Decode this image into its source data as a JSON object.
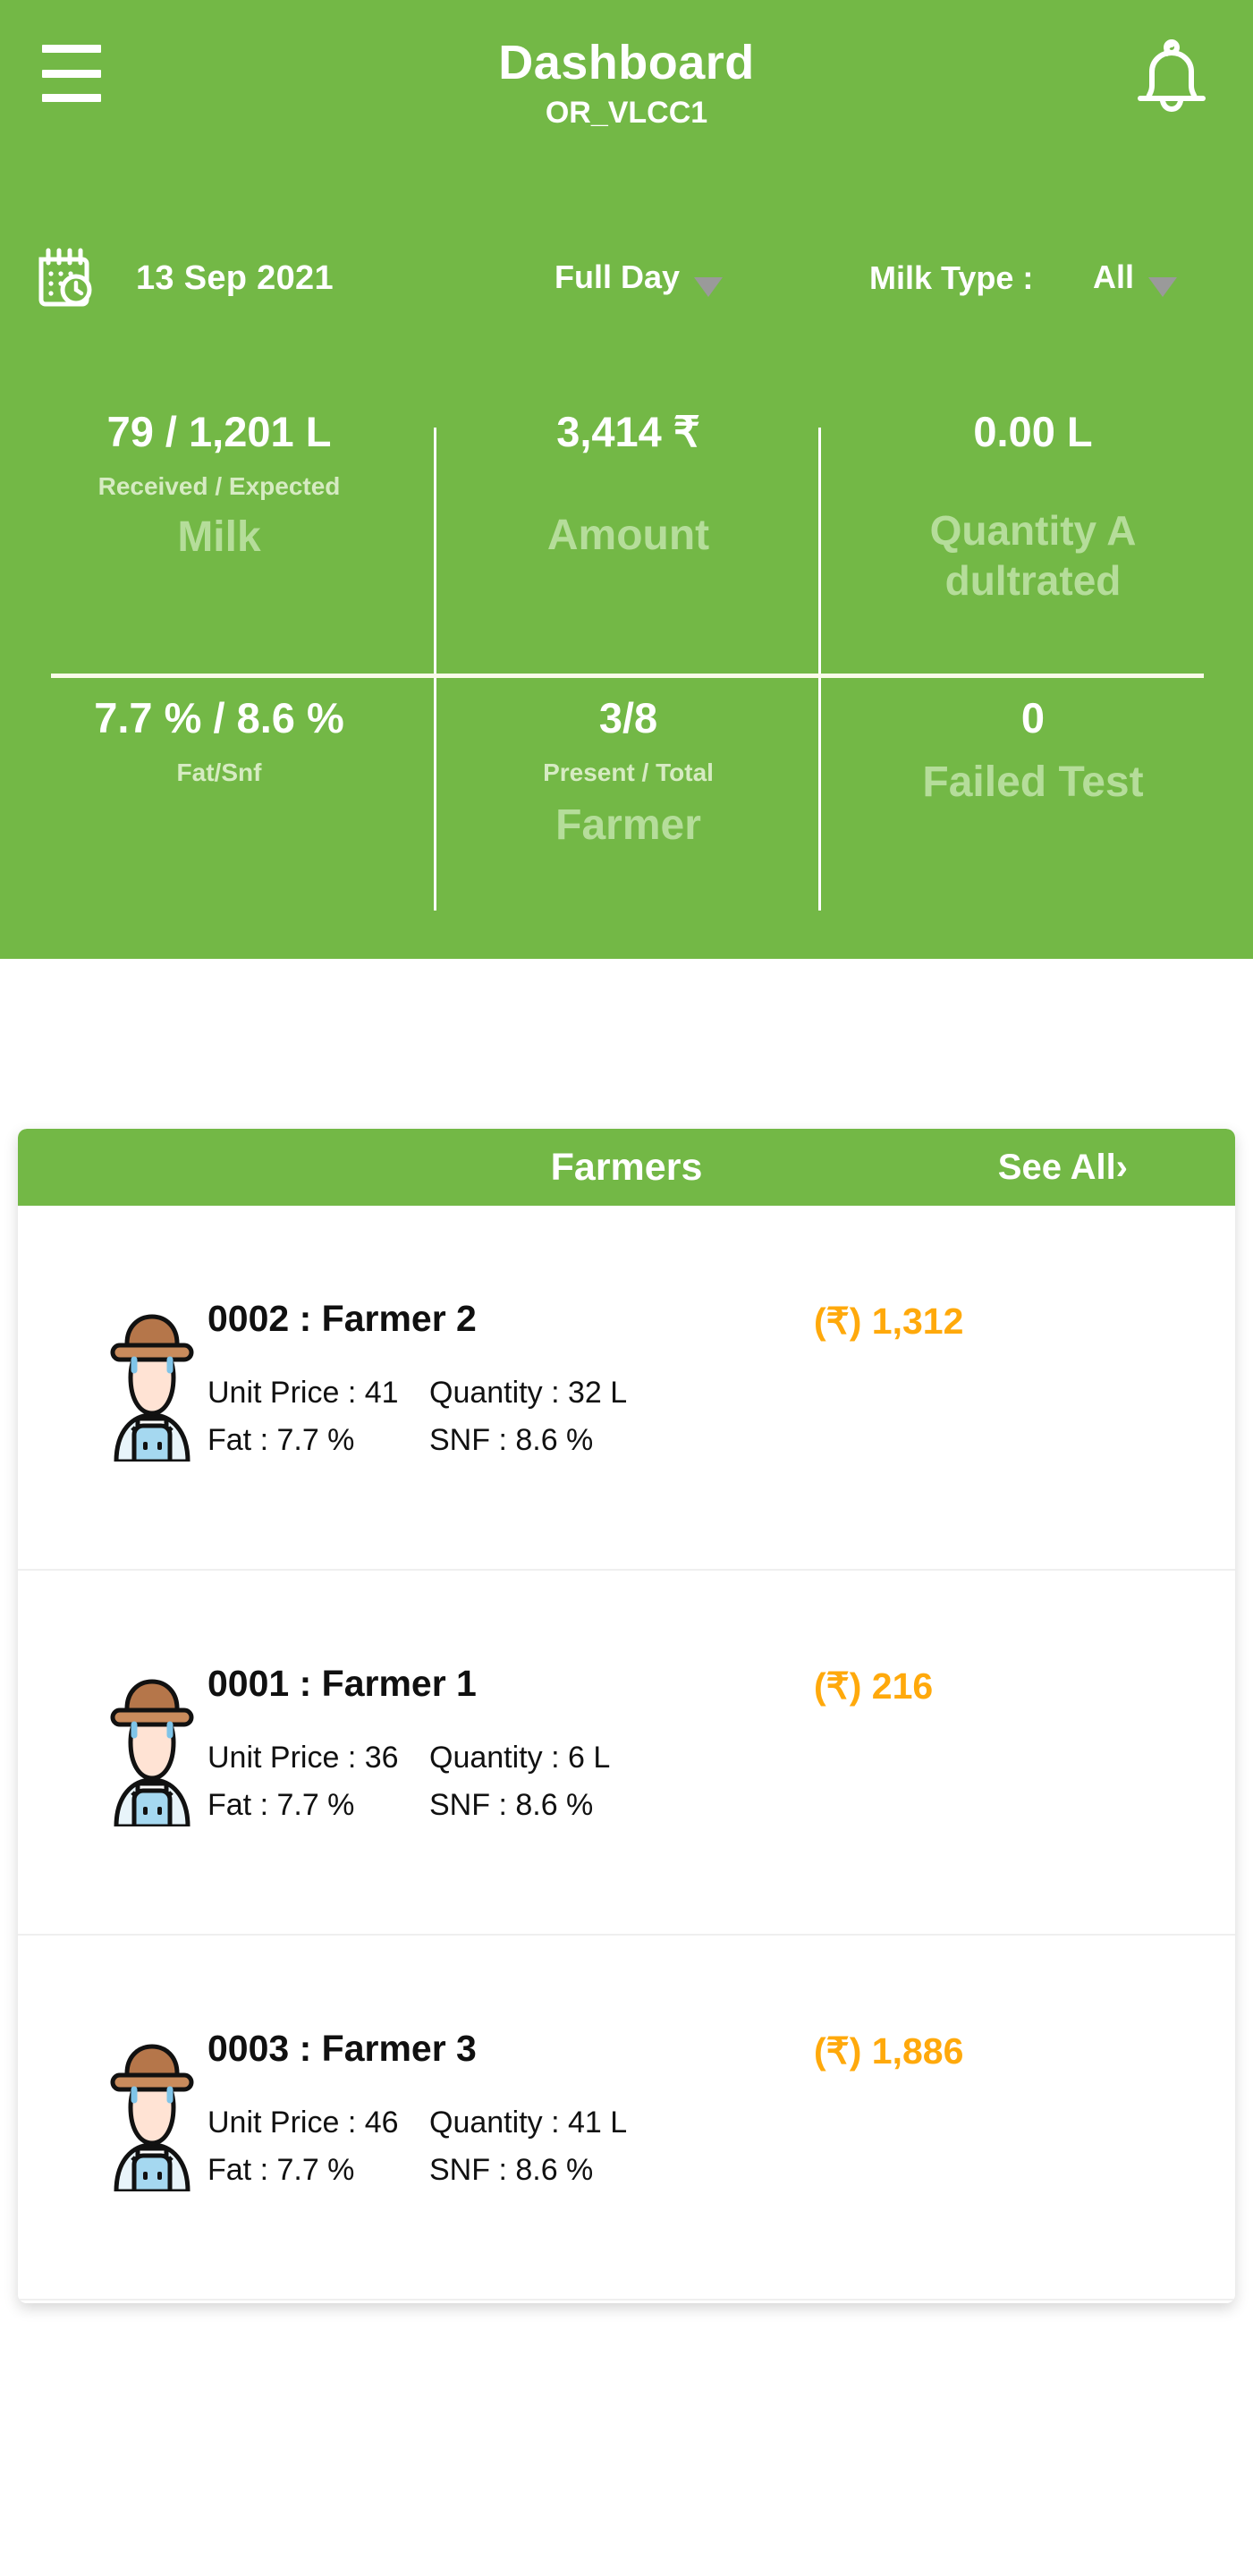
{
  "theme": {
    "green": "#73B846",
    "light_green_label": "#B5DD9A",
    "sub_label": "#D6EBC2",
    "amount_orange": "#FFA90B",
    "card_bg": "#FFFFFF"
  },
  "header": {
    "menu_icon": "hamburger-menu-icon",
    "title": "Dashboard",
    "subtitle": "OR_VLCC1",
    "notification_icon": "bell-icon"
  },
  "filters": {
    "calendar_icon": "calendar-clock-icon",
    "date": "13 Sep 2021",
    "shift": {
      "label": "Full Day",
      "caret": "chevron-down-icon"
    },
    "milk_type": {
      "label": "Milk Type :",
      "value": "All",
      "caret": "chevron-down-icon"
    }
  },
  "stats": [
    {
      "value": "79 / 1,201",
      "unit": "L",
      "sub": "Received / Expected",
      "name": "Milk"
    },
    {
      "value": "3,414",
      "unit": "₹",
      "sub": "",
      "name": "Amount"
    },
    {
      "value": "0.00",
      "unit": "L",
      "sub": "",
      "name": "Quantity A dultrated"
    },
    {
      "value": "7.7 % / 8.6 %",
      "unit": "",
      "sub": "Fat/Snf",
      "name": ""
    },
    {
      "value": "3/8",
      "unit": "",
      "sub": "Present / Total",
      "name": "Farmer"
    },
    {
      "value": "0",
      "unit": "",
      "sub": "",
      "name": "Failed Test"
    }
  ],
  "farmers_card": {
    "title": "Farmers",
    "see_all": "See All›",
    "labels": {
      "unit_price": "Unit Price :",
      "quantity": "Quantity :",
      "fat": "Fat :",
      "snf": "SNF :",
      "currency": "(₹)"
    },
    "rows": [
      {
        "name": "0002 : Farmer 2",
        "amount": "(₹) 1,312",
        "unit_price": "Unit Price : 41",
        "quantity": "Quantity : 32 L",
        "fat": "Fat : 7.7 %",
        "snf": "SNF : 8.6 %",
        "avatar": "farmer-avatar-icon"
      },
      {
        "name": "0001 : Farmer 1",
        "amount": "(₹) 216",
        "unit_price": "Unit Price : 36",
        "quantity": "Quantity : 6 L",
        "fat": "Fat : 7.7 %",
        "snf": "SNF : 8.6 %",
        "avatar": "farmer-avatar-icon"
      },
      {
        "name": "0003 : Farmer 3",
        "amount": "(₹) 1,886",
        "unit_price": "Unit Price : 46",
        "quantity": "Quantity : 41 L",
        "fat": "Fat : 7.7 %",
        "snf": "SNF : 8.6 %",
        "avatar": "farmer-avatar-icon"
      }
    ]
  }
}
